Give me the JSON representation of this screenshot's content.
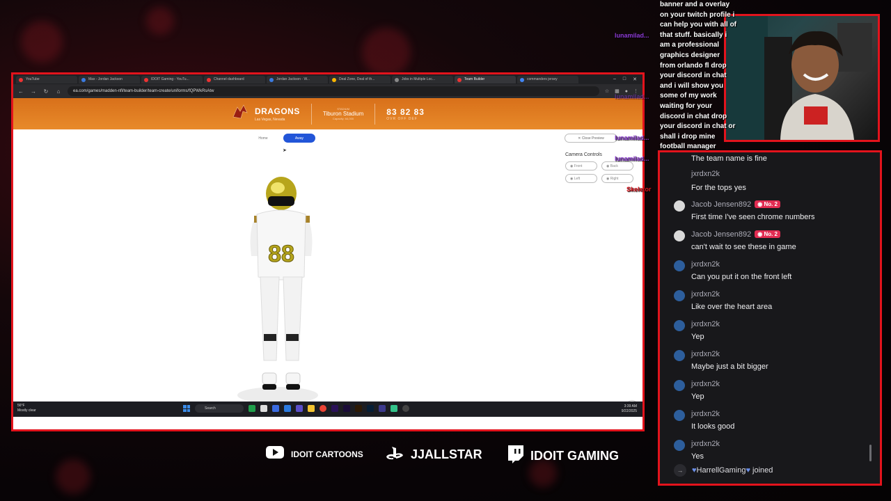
{
  "browser": {
    "tabs": [
      {
        "label": "YouTube"
      },
      {
        "label": "Max - Jordan Jackson"
      },
      {
        "label": "IDOIT Gaming - YouTu..."
      },
      {
        "label": "Channel dashboard"
      },
      {
        "label": "Jordan Jackson - W..."
      },
      {
        "label": "Deal Zone, Deal of th..."
      },
      {
        "label": "Jobs in Multiple Loc..."
      },
      {
        "label": "Team Builder"
      },
      {
        "label": "commanders jersey"
      }
    ],
    "url": "ea.com/games/madden-nfl/team-builder/team-create/uniforms/fQPWkRsAtw"
  },
  "team_builder": {
    "team_name": "DRAGONS",
    "team_city": "Las Vegas, Nevada",
    "stadium_label": "STADIUM",
    "stadium_name": "Tiburon Stadium",
    "stadium_capacity": "Capacity: 64,000",
    "ratings": "83 82 83",
    "ratings_label": "OVR OFF DEF",
    "home_label": "Home",
    "away_label": "Away",
    "close_preview_label": "Close Preview",
    "camera_controls_title": "Camera Controls",
    "camera_buttons": [
      "Front",
      "Back",
      "Left",
      "Right"
    ],
    "jersey_number": "88"
  },
  "taskbar": {
    "weather_temp": "56°F",
    "weather_desc": "Mostly clear",
    "search_label": "Search",
    "time": "3:39 AM",
    "date": "9/22/2025"
  },
  "overlay_chat": {
    "message": "banner and a overlay on your twitch profile i can help you with all of that stuff. basically i am a professional graphics designer from orlando fl drop your discord in chat and i will show you some of my work waiting for your discord in chat drop your discord in chat or shall i drop mine football manager",
    "names": [
      "lunamilad...",
      "lunamilad...",
      "lunamilad...",
      "lunamilad...",
      "Skeletor"
    ]
  },
  "chat": {
    "partial_lines": [
      "The team name is fine",
      "jxrdxn2k",
      "For the tops yes"
    ],
    "messages": [
      {
        "user": "Jacob Jensen892",
        "badge": "No. 2",
        "text": "First time I've seen chrome numbers"
      },
      {
        "user": "Jacob Jensen892",
        "badge": "No. 2",
        "text": "can't wait to see these in game"
      },
      {
        "user": "jxrdxn2k",
        "text": "Can you put it on the front left"
      },
      {
        "user": "jxrdxn2k",
        "text": "Like over the heart area"
      },
      {
        "user": "jxrdxn2k",
        "text": "Yep"
      },
      {
        "user": "jxrdxn2k",
        "text": "Maybe just a bit bigger"
      },
      {
        "user": "jxrdxn2k",
        "text": "Yep"
      },
      {
        "user": "jxrdxn2k",
        "text": "It looks good"
      },
      {
        "user": "jxrdxn2k",
        "text": "Yes"
      }
    ],
    "join_user": "HarrellGaming",
    "join_text": "joined"
  },
  "socials": [
    {
      "icon": "youtube-icon",
      "label": "IDOIT CARTOONS"
    },
    {
      "icon": "playstation-icon",
      "label": "JJALLSTAR"
    },
    {
      "icon": "twitch-icon",
      "label": "IDOIT GAMING"
    }
  ],
  "colors": {
    "frame_red": "#e3131c",
    "header_orange": "#e07a22",
    "away_blue": "#2255d8",
    "badge_red": "#e22c52",
    "overlay_name_purple": "#8e3bd6"
  }
}
